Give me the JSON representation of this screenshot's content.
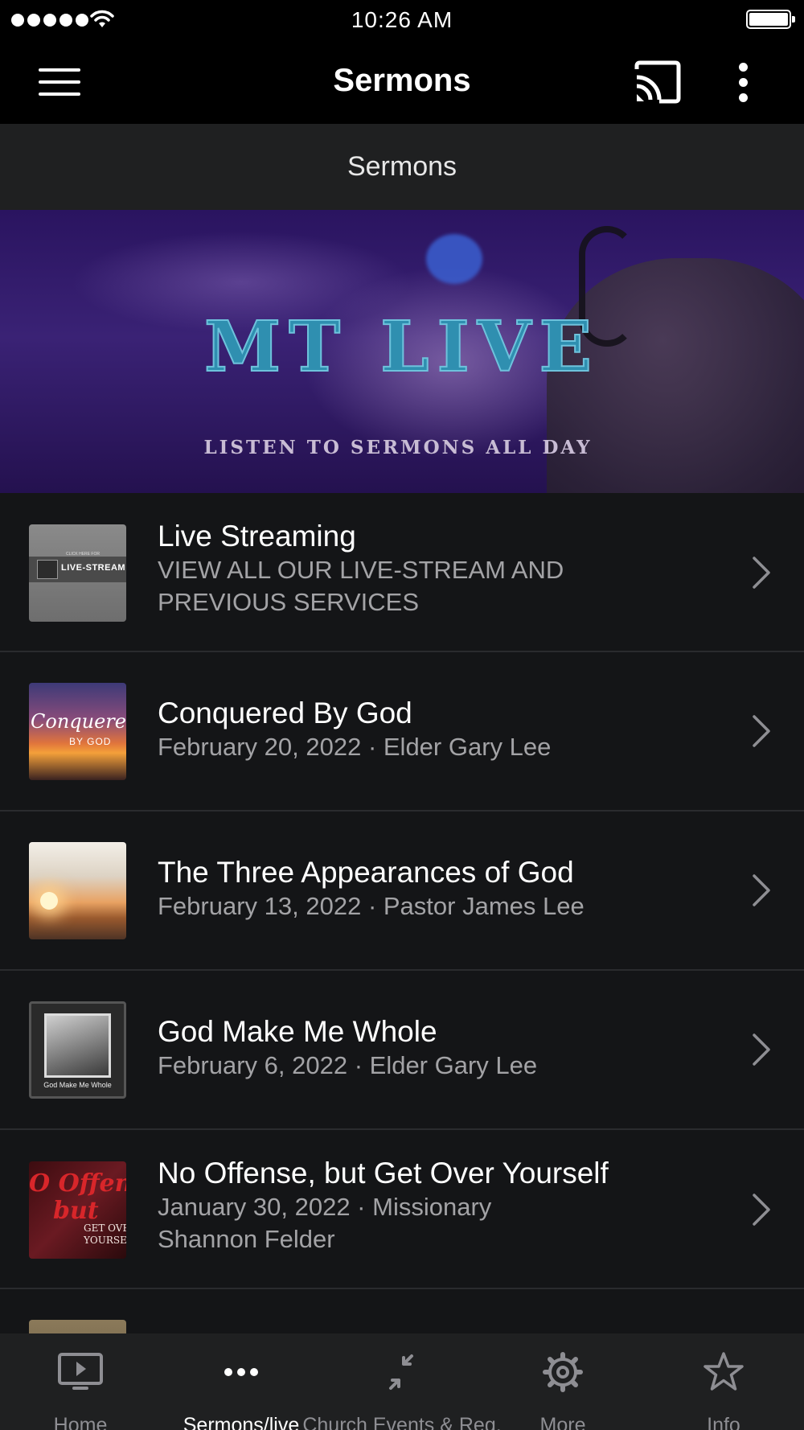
{
  "status_bar": {
    "time": "10:26 AM"
  },
  "app_bar": {
    "title": "Sermons",
    "menu_icon": "hamburger-icon",
    "cast_icon": "cast-icon",
    "overflow_icon": "more-vertical-icon"
  },
  "section": {
    "title": "Sermons"
  },
  "banner": {
    "title": "MT LIVE",
    "subtitle": "LISTEN TO SERMONS ALL DAY"
  },
  "list": {
    "items": [
      {
        "title": "Live Streaming",
        "subtitle_line1": "VIEW ALL OUR LIVE-STREAM AND",
        "subtitle_line2": "PREVIOUS SERVICES",
        "thumb_text": "LIVE-STREAM",
        "thumb_small": "CLICK HERE FOR"
      },
      {
        "title": "Conquered By God",
        "subtitle_line1": "February 20, 2022 · Elder Gary Lee",
        "thumb_text_a": "Conquered",
        "thumb_text_b": "BY GOD"
      },
      {
        "title": "The Three Appearances of God",
        "subtitle_line1": "February 13, 2022 · Pastor James Lee"
      },
      {
        "title": "God Make Me Whole",
        "subtitle_line1": "February 6, 2022 · Elder Gary Lee",
        "thumb_caption": "God Make Me Whole"
      },
      {
        "title": "No Offense, but Get Over Yourself",
        "subtitle_line1": "January 30, 2022 · Missionary",
        "subtitle_line2": "Shannon Felder",
        "thumb_text_a": "O Offense",
        "thumb_text_b": "but",
        "thumb_text_c1": "GET OVER",
        "thumb_text_c2": "YOURSELF"
      }
    ]
  },
  "tab_bar": {
    "tabs": [
      {
        "label": "Home",
        "icon": "tv-play-icon",
        "active": false
      },
      {
        "label": "Sermons/live",
        "icon": "more-horizontal-icon",
        "active": true
      },
      {
        "label": "Church Events & Reg.",
        "icon": "collapse-arrows-icon",
        "active": false
      },
      {
        "label": "More",
        "icon": "gear-icon",
        "active": false
      },
      {
        "label": "Info",
        "icon": "star-icon",
        "active": false
      }
    ]
  },
  "colors": {
    "background": "#000000",
    "list_background": "#141517",
    "section_header_bg": "#1f2021",
    "secondary_text": "#a3a3a6",
    "tab_inactive": "#8e8e93",
    "banner_title": "#2f8fb0"
  }
}
